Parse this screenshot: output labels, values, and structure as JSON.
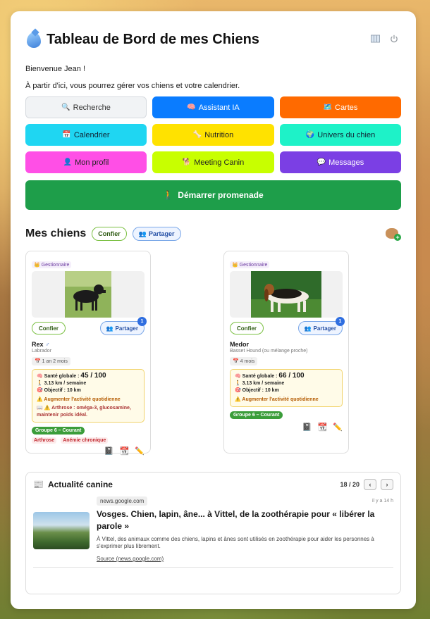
{
  "header": {
    "title": "Tableau de Bord de mes Chiens",
    "icons": [
      "map-icon",
      "power-icon"
    ]
  },
  "welcome": "Bienvenue Jean !",
  "intro": "À partir d'ici, vous pourrez gérer vos chiens et votre calendrier.",
  "menu": [
    {
      "label": "Recherche",
      "icon": "🔍",
      "bg": "#f1f3f5",
      "fg": "#333",
      "border": "#d6dadf",
      "name": "search-button"
    },
    {
      "label": "Assistant IA",
      "icon": "🧠",
      "bg": "#0a7cff",
      "fg": "#ffffff",
      "border": "#0a7cff",
      "name": "ai-assistant-button"
    },
    {
      "label": "Cartes",
      "icon": "🗺️",
      "bg": "#ff6a00",
      "fg": "#ffffff",
      "border": "#ff6a00",
      "name": "maps-button"
    },
    {
      "label": "Calendrier",
      "icon": "📅",
      "bg": "#1fd6f2",
      "fg": "#123",
      "border": "#1fd6f2",
      "name": "calendar-button"
    },
    {
      "label": "Nutrition",
      "icon": "🦴",
      "bg": "#ffe200",
      "fg": "#222",
      "border": "#ffe200",
      "name": "nutrition-button"
    },
    {
      "label": "Univers du chien",
      "icon": "🌍",
      "bg": "#1ef2c8",
      "fg": "#123",
      "border": "#1ef2c8",
      "name": "dog-universe-button"
    },
    {
      "label": "Mon profil",
      "icon": "👤",
      "bg": "#ff4fe6",
      "fg": "#222",
      "border": "#ff4fe6",
      "name": "profile-button"
    },
    {
      "label": "Meeting Canin",
      "icon": "🐕",
      "bg": "#c8ff00",
      "fg": "#222",
      "border": "#c8ff00",
      "name": "meeting-button"
    },
    {
      "label": "Messages",
      "icon": "💬",
      "bg": "#7b3fe4",
      "fg": "#ffffff",
      "border": "#7b3fe4",
      "name": "messages-button"
    }
  ],
  "start_walk": {
    "label": "Démarrer promenade",
    "icon": "🚶"
  },
  "dogs_section": {
    "title": "Mes chiens",
    "confier": "Confier",
    "partager": "Partager"
  },
  "dogs": [
    {
      "role": "Gestionnaire",
      "confier": "Confier",
      "partager": "Partager",
      "share_count": "1",
      "name": "Rex",
      "sex": "♂",
      "breed": "Labrador",
      "age": "1 an 2 mois",
      "health_label": "Santé globale :",
      "health_score": "45 / 100",
      "distance": "3.13 km / semaine",
      "goal": "Objectif : 10 km",
      "warning": "Augmenter l'activité quotidienne",
      "reco": "Arthrose : oméga-3, glucosamine, maintenir poids idéal.",
      "group": "Groupe 6 – Courant",
      "tags": [
        "Arthrose",
        "Anémie chronique"
      ]
    },
    {
      "role": "Gestionnaire",
      "confier": "Confier",
      "partager": "Partager",
      "share_count": "1",
      "name": "Medor",
      "sex": "",
      "breed": "Basset Hound (ou mélange proche)",
      "age": "4 mois",
      "health_label": "Santé globale :",
      "health_score": "66 / 100",
      "distance": "3.13 km / semaine",
      "goal": "Objectif : 10 km",
      "warning": "Augmenter l'activité quotidienne",
      "reco": "",
      "group": "Groupe 6 – Courant",
      "tags": []
    }
  ],
  "news": {
    "title": "Actualité canine",
    "counter": "18 / 20",
    "prev": "‹",
    "next": "›",
    "article": {
      "source": "news.google.com",
      "time": "il y a 14 h",
      "headline": "Vosges. Chien, lapin, âne... à Vittel, de la zoothérapie pour « libérer la parole »",
      "summary": "À Vittel, des animaux comme des chiens, lapins et ânes sont utilisés en zoothérapie pour aider les personnes à s'exprimer plus librement.",
      "link": "Source (news.google.com)"
    }
  }
}
